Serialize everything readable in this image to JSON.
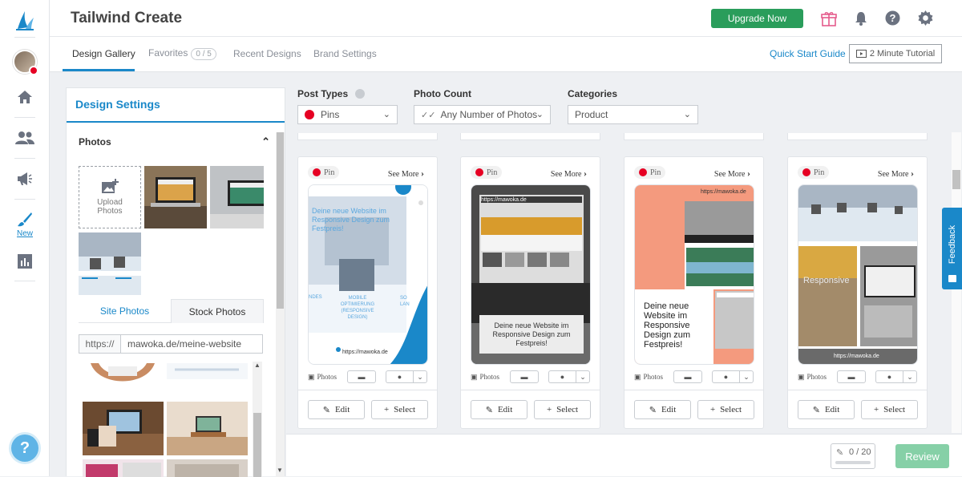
{
  "app": {
    "title": "Tailwind Create",
    "upgrade_label": "Upgrade Now"
  },
  "rail": {
    "new_label": "New"
  },
  "tabs": [
    {
      "label": "Design Gallery"
    },
    {
      "label": "Favorites"
    },
    {
      "label": "Recent Designs"
    },
    {
      "label": "Brand Settings"
    }
  ],
  "favorites_count": "0 / 5",
  "quick_start_label": "Quick Start Guide",
  "tutorial_label": "2 Minute Tutorial",
  "settings": {
    "title": "Design Settings",
    "photos_label": "Photos",
    "upload_label_line1": "Upload",
    "upload_label_line2": "Photos",
    "site_photos_tab": "Site Photos",
    "stock_photos_tab": "Stock Photos",
    "url_prefix": "https://",
    "url_value": "mawoka.de/meine-website"
  },
  "filters": {
    "post_types_label": "Post Types",
    "post_types_value": "Pins",
    "photo_count_label": "Photo Count",
    "photo_count_value": "Any Number of Photos",
    "categories_label": "Categories",
    "categories_value": "Product"
  },
  "cards": [
    {
      "badge": "Pin",
      "see_more": "See More",
      "photos_label": "Photos",
      "edit_label": "Edit",
      "select_label": "Select",
      "headline": "Deine neue Website im Responsive Design zum Festpreis!",
      "sub": "MOBILE OPTIMIERUNG (RESPONSIVE DESIGN)",
      "side_left": "NDES",
      "side_right": "SO LAN",
      "url": "https://mawoka.de"
    },
    {
      "badge": "Pin",
      "see_more": "See More",
      "photos_label": "Photos",
      "edit_label": "Edit",
      "select_label": "Select",
      "headline": "Deine neue Website im Responsive Design zum Festpreis!",
      "url": "https://mawoka.de"
    },
    {
      "badge": "Pin",
      "see_more": "See More",
      "photos_label": "Photos",
      "edit_label": "Edit",
      "select_label": "Select",
      "headline": "Deine neue Website im Responsive Design zum Festpreis!",
      "url": "https://mawoka.de"
    },
    {
      "badge": "Pin",
      "see_more": "See More",
      "photos_label": "Photos",
      "edit_label": "Edit",
      "select_label": "Select",
      "overlay": "Responsive",
      "url": "https://mawoka.de"
    }
  ],
  "footer": {
    "count": "0 / 20",
    "review_label": "Review"
  },
  "feedback_label": "Feedback",
  "colors": {
    "accent": "#1a88c9",
    "upgrade": "#2a9d5b",
    "review": "#86d0a7",
    "pinterest": "#e60023",
    "salmon": "#f49a7e"
  }
}
